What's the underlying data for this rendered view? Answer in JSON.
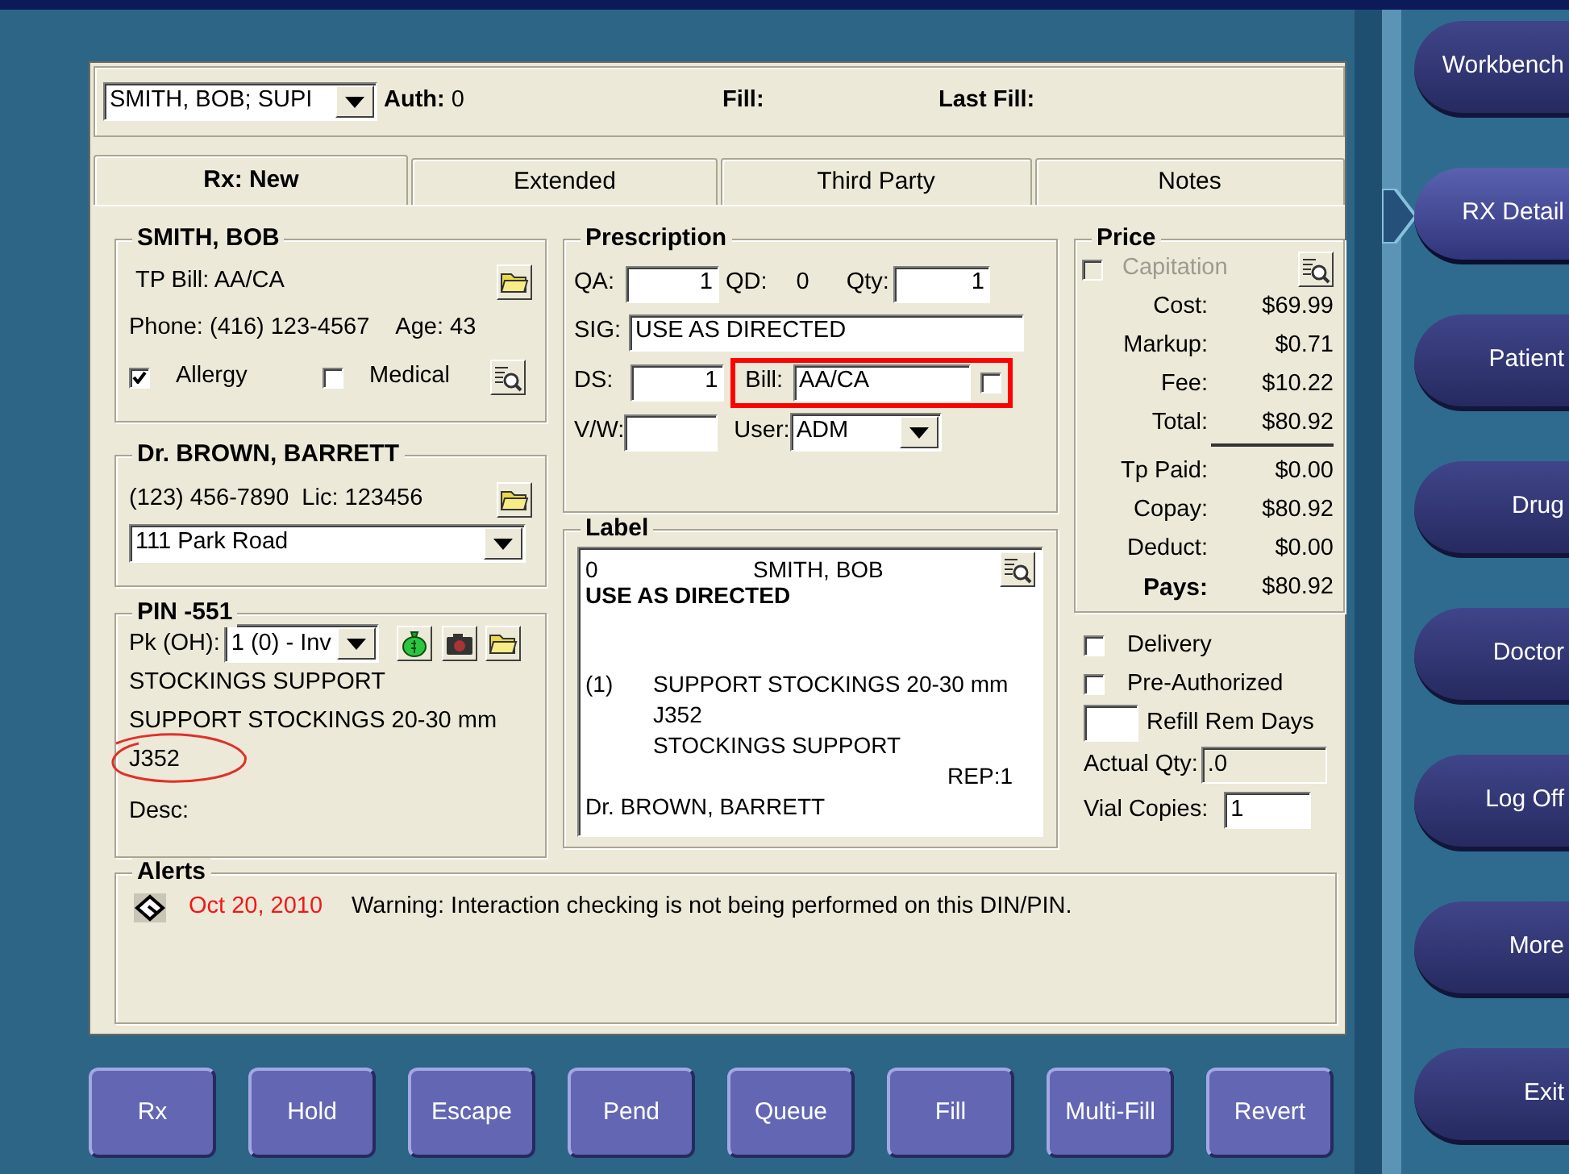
{
  "header": {
    "patient_select": "SMITH, BOB; SUPI",
    "auth_label": "Auth:",
    "auth": "0",
    "fill_label": "Fill:",
    "last_fill_label": "Last Fill:"
  },
  "tabs": [
    {
      "label": "Rx: New",
      "selected": true
    },
    {
      "label": "Extended",
      "selected": false
    },
    {
      "label": "Third Party",
      "selected": false
    },
    {
      "label": "Notes",
      "selected": false
    }
  ],
  "patient": {
    "name": "SMITH, BOB",
    "tp_bill": "TP Bill: AA/CA",
    "phone": "Phone: (416) 123-4567",
    "age": "Age: 43",
    "flags": [
      {
        "label": "Allergy",
        "checked": true
      },
      {
        "label": "Medical",
        "checked": false
      }
    ]
  },
  "doctor": {
    "name": "Dr. BROWN, BARRETT",
    "phone": "(123) 456-7890",
    "license": "Lic: 123456",
    "address": "111 Park Road"
  },
  "product": {
    "title": "PIN -551",
    "pack_label": "Pk (OH):",
    "pack": "1 (0) - Inv",
    "lines": [
      {
        "text": "STOCKINGS  SUPPORT",
        "circled": false
      },
      {
        "text": "SUPPORT STOCKINGS 20-30 mm",
        "circled": false
      },
      {
        "text": "J352",
        "circled": true
      }
    ],
    "desc_label": "Desc:"
  },
  "prescription": {
    "title": "Prescription",
    "qa_label": "QA:",
    "qa": "1",
    "qd_label": "QD:",
    "qd": "0",
    "qty_label": "Qty:",
    "qty": "1",
    "sig_label": "SIG:",
    "sig": "USE AS DIRECTED",
    "ds_label": "DS:",
    "ds": "1",
    "bill_label": "Bill:",
    "bill": "AA/CA",
    "bill_checked": false,
    "bill_highlighted": true,
    "vw_label": "V/W:",
    "user_label": "User:",
    "user": "ADM"
  },
  "label": {
    "title": "Label",
    "number": "0",
    "patient": "SMITH, BOB",
    "sig": "USE AS DIRECTED",
    "qty": "(1)",
    "drug_lines": [
      "SUPPORT STOCKINGS 20-30 mm",
      "J352",
      "STOCKINGS  SUPPORT"
    ],
    "repeats": "REP:1",
    "doctor": "Dr. BROWN, BARRETT"
  },
  "price": {
    "title": "Price",
    "capitation": {
      "label": "Capitation",
      "checked": false,
      "disabled": true
    },
    "rows": [
      {
        "label": "Cost:",
        "value": "$69.99",
        "kind": "normal"
      },
      {
        "label": "Markup:",
        "value": "$0.71",
        "kind": "normal"
      },
      {
        "label": "Fee:",
        "value": "$10.22",
        "kind": "normal"
      },
      {
        "label": "Total:",
        "value": "$80.92",
        "kind": "total"
      },
      {
        "label": "Tp Paid:",
        "value": "$0.00",
        "kind": "normal"
      },
      {
        "label": "Copay:",
        "value": "$80.92",
        "kind": "normal"
      },
      {
        "label": "Deduct:",
        "value": "$0.00",
        "kind": "normal"
      },
      {
        "label": "Pays:",
        "value": "$80.92",
        "kind": "emphasis"
      }
    ]
  },
  "options": [
    {
      "label": "Delivery",
      "checked": false
    },
    {
      "label": "Pre-Authorized",
      "checked": false
    }
  ],
  "refill_rem_days": {
    "label": "Refill Rem Days"
  },
  "actual_qty": {
    "label": "Actual Qty:",
    "value": ".0",
    "disabled": true
  },
  "vial_copies": {
    "label": "Vial Copies:",
    "value": "1"
  },
  "alerts": {
    "title": "Alerts",
    "items": [
      {
        "date": "Oct 20, 2010",
        "message": "Warning: Interaction checking is not being performed on this DIN/PIN."
      }
    ]
  },
  "actions": [
    "Rx",
    "Hold",
    "Escape",
    "Pend",
    "Queue",
    "Fill",
    "Multi-Fill",
    "Revert"
  ],
  "nav": [
    {
      "label": "Workbench",
      "selected": false
    },
    {
      "label": "RX Detail",
      "selected": true
    },
    {
      "label": "Patient",
      "selected": false
    },
    {
      "label": "Drug",
      "selected": false
    },
    {
      "label": "Doctor",
      "selected": false
    },
    {
      "label": "Log Off",
      "selected": false
    },
    {
      "label": "More",
      "selected": false
    },
    {
      "label": "Exit",
      "selected": false
    }
  ]
}
